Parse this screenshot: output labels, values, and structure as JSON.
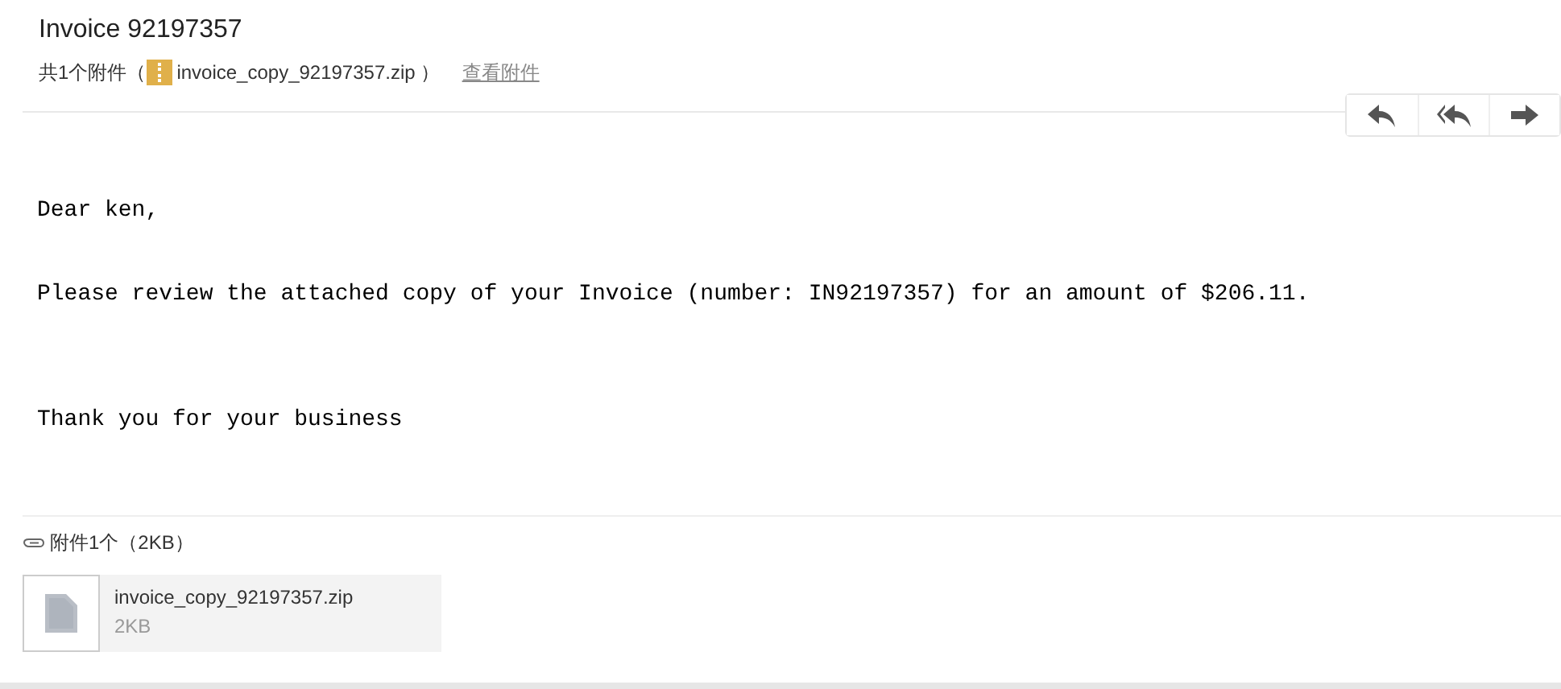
{
  "subject": "Invoice 92197357",
  "attachment_summary": {
    "count_label": "共1个附件（",
    "file_name": "invoice_copy_92197357.zip",
    "close": "）",
    "view_link": "查看附件"
  },
  "actions": [
    {
      "kind": "reply"
    },
    {
      "kind": "reply_all"
    },
    {
      "kind": "forward"
    }
  ],
  "body": [
    "Dear ken,",
    "Please review the attached copy of your Invoice (number: IN92197357) for an amount of $206.11.",
    "Thank you for your business"
  ],
  "attachments": {
    "heading": "附件1个（2KB）",
    "files": [
      {
        "name": "invoice_copy_92197357.zip",
        "size": "2KB"
      }
    ]
  }
}
